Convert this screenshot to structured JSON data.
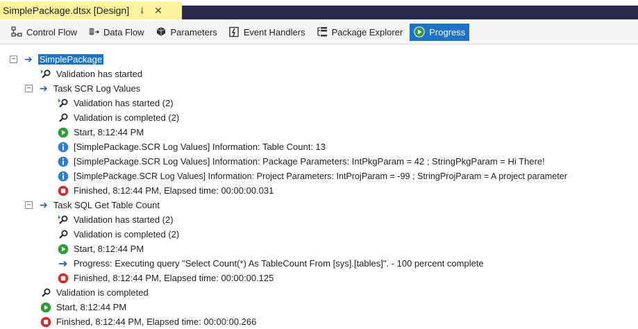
{
  "window": {
    "tab_title": "SimplePackage.dtsx [Design]",
    "pin_glyph": "⊸",
    "close_glyph": "✕"
  },
  "toolbar": {
    "control_flow": "Control Flow",
    "data_flow": "Data Flow",
    "parameters": "Parameters",
    "event_handlers": "Event Handlers",
    "package_explorer": "Package Explorer",
    "progress": "Progress"
  },
  "tree": {
    "root": "SimplePackage",
    "root_validation_started": "Validation has started",
    "task1": {
      "title": "Task SCR Log Values",
      "validation_started": "Validation has started (2)",
      "validation_completed": "Validation is completed (2)",
      "start": "Start, 8:12:44 PM",
      "info1": "[SimplePackage.SCR Log Values] Information: Table Count: 13",
      "info2": "[SimplePackage.SCR Log Values] Information: Package Parameters: IntPkgParam = 42 ; StringPkgParam = Hi There!",
      "info3": "[SimplePackage.SCR Log Values] Information: Project Parameters: IntProjParam = -99 ; StringProjParam = A project parameter",
      "finished": "Finished, 8:12:44 PM, Elapsed time: 00:00:00.031"
    },
    "task2": {
      "title": "Task SQL Get Table Count",
      "validation_started": "Validation has started (2)",
      "validation_completed": "Validation is completed (2)",
      "start": "Start, 8:12:44 PM",
      "progress": "Progress: Executing query \"Select Count(*) As TableCount From [sys].[tables]\". - 100 percent complete",
      "finished": "Finished, 8:12:44 PM, Elapsed time: 00:00:00.125"
    },
    "root_validation_completed": "Validation is completed",
    "root_start": "Start, 8:12:44 PM",
    "root_finished": "Finished, 8:12:44 PM, Elapsed time: 00:00:00.266"
  },
  "colors": {
    "tab_yellow": "#fff29d",
    "tab_strip": "#2b2b4d",
    "accent_blue": "#1c73c8",
    "start_green": "#2e9b3a",
    "stop_red": "#d02b2b",
    "info_blue": "#2f7cd3"
  }
}
